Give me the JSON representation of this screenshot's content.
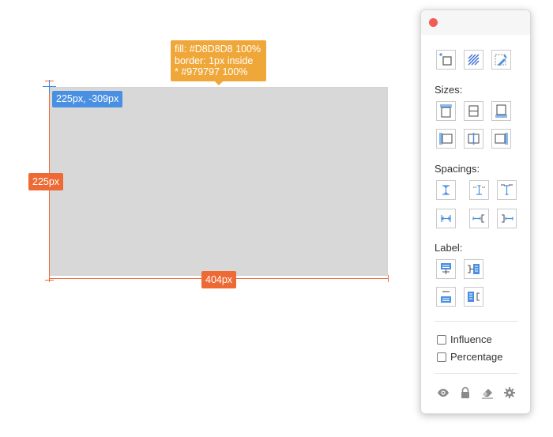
{
  "canvas": {
    "position_label": "225px, -309px",
    "height_label": "225px",
    "width_label": "404px",
    "tooltip": {
      "fill": "fill: #D8D8D8 100%",
      "border": "border: 1px inside",
      "border_color": " * #979797 100%"
    },
    "rect_fill": "#D8D8D8"
  },
  "panel": {
    "sizes_label": "Sizes:",
    "spacings_label": "Spacings:",
    "label_label": "Label:",
    "influence_label": "Influence",
    "percentage_label": "Percentage"
  },
  "colors": {
    "accent_blue": "#4a90e2",
    "measure_orange": "#ee6a35",
    "tooltip_orange": "#f0a73a",
    "close_red": "#f25c54"
  }
}
